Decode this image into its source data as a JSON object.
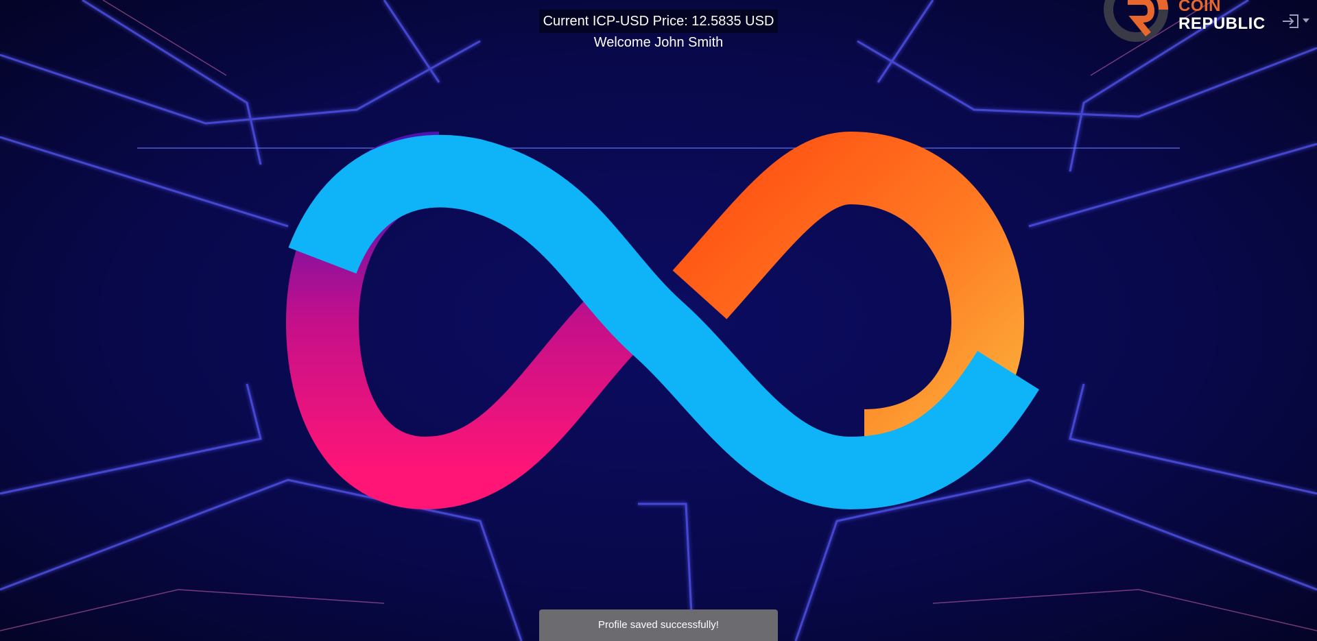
{
  "header": {
    "price_text": "Current ICP-USD Price: 12.5835 USD",
    "welcome_text": "Welcome John Smith"
  },
  "brand": {
    "line1": "COIN",
    "line2": "REPUBLIC",
    "accent_color": "#e8672c"
  },
  "user_menu": {
    "icon": "login-icon",
    "dropdown_icon": "caret-down-icon"
  },
  "hero": {
    "logo": "icp-infinity-logo",
    "colors": {
      "blue": "#0fb4f8",
      "orange_light": "#fbb03b",
      "orange_dark": "#ff4e12",
      "pink": "#ff1576",
      "purple": "#4e12b2"
    }
  },
  "toast": {
    "message": "Profile saved successfully!"
  }
}
